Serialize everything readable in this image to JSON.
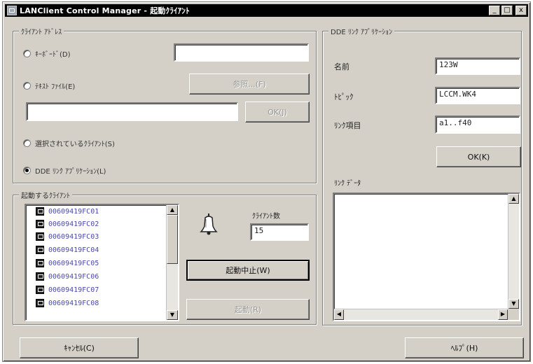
{
  "window": {
    "title": "LANClient Control Manager - 起動ｸﾗｲｱﾝﾄ",
    "controls": [
      "_",
      "□",
      "x"
    ]
  },
  "client_address": {
    "legend": "ｸﾗｲｱﾝﾄ ｱﾄﾞﾚｽ",
    "keyboard_label": "ｷｰﾎﾞｰﾄﾞ(D)",
    "keyboard_value": "",
    "textfile_label": "ﾃｷｽﾄ ﾌｧｲﾙ(E)",
    "browse_label": "参照...(F)",
    "textfile_value": "",
    "ok_label": "OK(J)",
    "selected_label": "選択されているｸﾗｲｱﾝﾄ(S)",
    "dde_label": "DDE ﾘﾝｸ ｱﾌﾟﾘｹｰｼｮﾝ(L)",
    "selected_option": "dde"
  },
  "dde_link": {
    "legend": "DDE ﾘﾝｸ ｱﾌﾟﾘｹｰｼｮﾝ",
    "name_label": "名前",
    "name_value": "123W",
    "topic_label": "ﾄﾋﾟｯｸ",
    "topic_value": "LCCM.WK4",
    "item_label": "ﾘﾝｸ項目",
    "item_value": "a1..f40",
    "ok_label": "OK(K)",
    "data_label": "ﾘﾝｸ ﾃﾞｰﾀ",
    "data_value": ""
  },
  "start_clients": {
    "legend": "起動するｸﾗｲｱﾝﾄ",
    "items": [
      "00609419FC01",
      "00609419FC02",
      "00609419FC03",
      "00609419FC04",
      "00609419FC05",
      "00609419FC06",
      "00609419FC07",
      "00609419FC08"
    ],
    "count_label": "ｸﾗｲｱﾝﾄ数",
    "count_value": "15",
    "stop_label": "起動中止(W)",
    "start_label": "起動(R)"
  },
  "footer": {
    "cancel_label": "ｷｬﾝｾﾙ(C)",
    "help_label": "ﾍﾙﾌﾟ(H)"
  },
  "icons": {
    "app": "app-icon",
    "bell": "bell-icon",
    "computer": "computer-icon"
  }
}
